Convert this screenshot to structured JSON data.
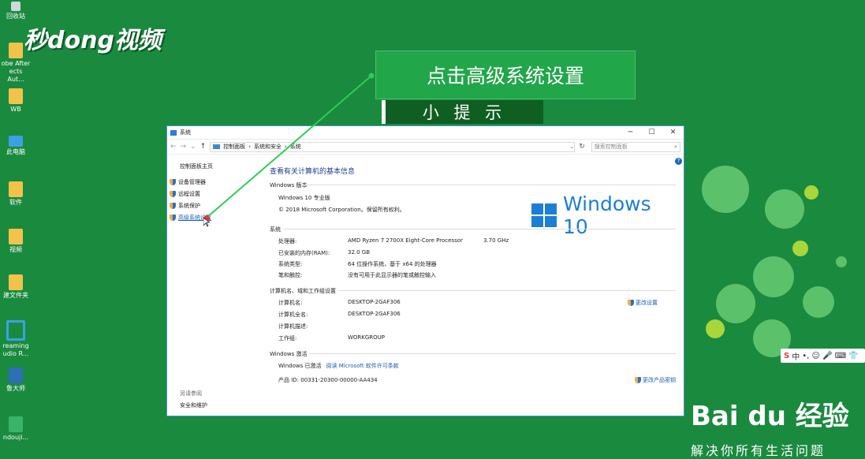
{
  "desktop_icons": [
    {
      "label": "回收站",
      "icon": "recycle-bin-icon"
    },
    {
      "label": "obe After\nects Aut...",
      "icon": "folder-icon"
    },
    {
      "label": "WB",
      "icon": "folder-icon"
    },
    {
      "label": "此电脑",
      "icon": "computer-icon"
    },
    {
      "label": "软件",
      "icon": "folder-icon"
    },
    {
      "label": "视频",
      "icon": "folder-icon"
    },
    {
      "label": "建文件夹",
      "icon": "folder-icon"
    },
    {
      "label": "reaming\nudio R...",
      "icon": "audio-app-icon"
    },
    {
      "label": "鲁大师",
      "icon": "app-icon"
    },
    {
      "label": "ndouji...",
      "icon": "app-icon"
    }
  ],
  "watermark": {
    "logo": "秒dong视频"
  },
  "callout": {
    "text": "点击高级系统设置",
    "tip": "小 提 示"
  },
  "ime": {
    "logo": "S",
    "lang": "中",
    "items": "•, ☺ 🎤 ⌨ 👕"
  },
  "baidu": {
    "logo": "Bai du 经验",
    "slogan": "解决你所有生活问题"
  },
  "window": {
    "title": "系统",
    "controls": {
      "minimize": "─",
      "maximize": "☐",
      "close": "✕"
    },
    "breadcrumb": [
      "控制面板",
      "系统和安全",
      "系统"
    ],
    "search_placeholder": "搜索控制面板",
    "sidebar": {
      "home": "控制面板主页",
      "items": [
        "设备管理器",
        "远程设置",
        "系统保护",
        "高级系统设置"
      ],
      "see_also": "另请参阅",
      "security": "安全和维护"
    },
    "heading": "查看有关计算机的基本信息",
    "edition": {
      "section": "Windows 版本",
      "name": "Windows 10 专业版",
      "copyright": "© 2018 Microsoft Corporation。保留所有权利。",
      "logo_text": "Windows 10"
    },
    "system": {
      "section": "系统",
      "rows": [
        {
          "k": "处理器:",
          "v": "AMD Ryzen 7 2700X Eight-Core Processor",
          "x": "3.70 GHz"
        },
        {
          "k": "已安装的内存(RAM):",
          "v": "32.0 GB",
          "x": ""
        },
        {
          "k": "系统类型:",
          "v": "64 位操作系统，基于 x64 的处理器",
          "x": ""
        },
        {
          "k": "笔和触控:",
          "v": "没有可用于此显示器的笔或触控输入",
          "x": ""
        }
      ]
    },
    "computer": {
      "section": "计算机名、域和工作组设置",
      "rows": [
        {
          "k": "计算机名:",
          "v": "DESKTOP-2GAF306"
        },
        {
          "k": "计算机全名:",
          "v": "DESKTOP-2GAF306"
        },
        {
          "k": "计算机描述:",
          "v": ""
        },
        {
          "k": "工作组:",
          "v": "WORKGROUP"
        }
      ],
      "change_link": "更改设置"
    },
    "activation": {
      "section": "Windows 激活",
      "status": "Windows 已激活",
      "license_link": "阅读 Microsoft 软件许可条款",
      "product_id": "产品 ID: 00331-20300-00000-AA434",
      "change_key": "更改产品密钥"
    }
  }
}
